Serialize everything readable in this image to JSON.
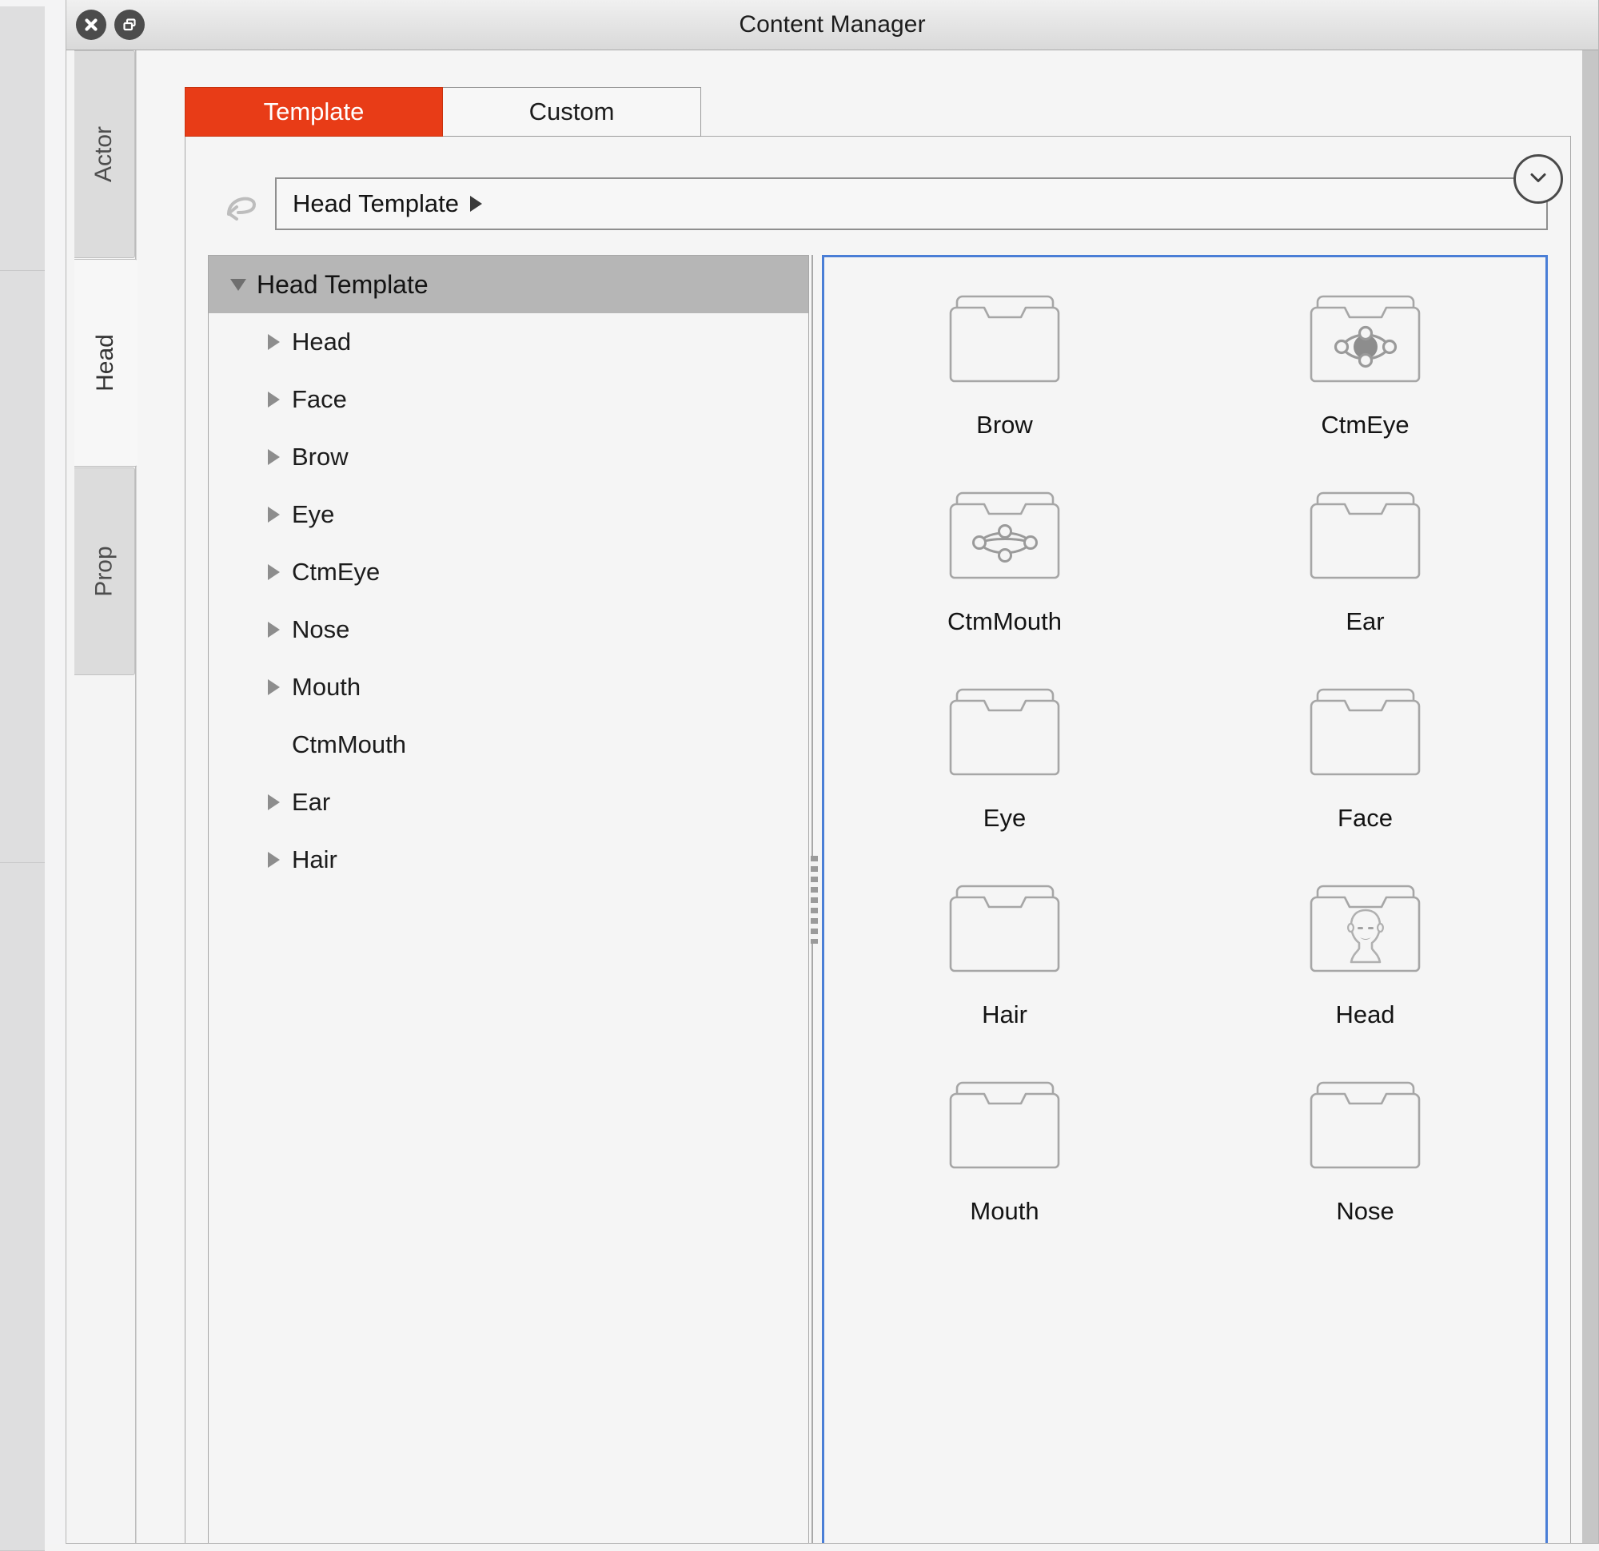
{
  "window": {
    "title": "Content Manager",
    "close_icon": "close-icon",
    "restore_icon": "restore-window-icon"
  },
  "side_tabs": [
    {
      "label": "Actor",
      "selected": false
    },
    {
      "label": "Head",
      "selected": true
    },
    {
      "label": "Prop",
      "selected": false
    }
  ],
  "tabs": [
    {
      "label": "Template",
      "active": true
    },
    {
      "label": "Custom",
      "active": false
    }
  ],
  "collapse_button": {
    "icon": "chevron-down-icon"
  },
  "breadcrumb": {
    "back_icon": "back-arrow-icon",
    "path": "Head Template",
    "arrow_icon": "caret-right-icon"
  },
  "tree": {
    "root": {
      "label": "Head Template",
      "expanded": true,
      "selected": true
    },
    "children": [
      {
        "label": "Head",
        "expandable": true
      },
      {
        "label": "Face",
        "expandable": true
      },
      {
        "label": "Brow",
        "expandable": true
      },
      {
        "label": "Eye",
        "expandable": true
      },
      {
        "label": "CtmEye",
        "expandable": true
      },
      {
        "label": "Nose",
        "expandable": true
      },
      {
        "label": "Mouth",
        "expandable": true
      },
      {
        "label": "CtmMouth",
        "expandable": false
      },
      {
        "label": "Ear",
        "expandable": true
      },
      {
        "label": "Hair",
        "expandable": true
      }
    ]
  },
  "splitter": {
    "icon": "drag-handle-icon"
  },
  "grid": {
    "items": [
      {
        "label": "Brow",
        "icon": "folder-plain-icon"
      },
      {
        "label": "CtmEye",
        "icon": "folder-eye-icon"
      },
      {
        "label": "CtmMouth",
        "icon": "folder-mouth-icon"
      },
      {
        "label": "Ear",
        "icon": "folder-plain-icon"
      },
      {
        "label": "Eye",
        "icon": "folder-plain-icon"
      },
      {
        "label": "Face",
        "icon": "folder-plain-icon"
      },
      {
        "label": "Hair",
        "icon": "folder-plain-icon"
      },
      {
        "label": "Head",
        "icon": "folder-head-icon"
      },
      {
        "label": "Mouth",
        "icon": "folder-plain-icon"
      },
      {
        "label": "Nose",
        "icon": "folder-plain-icon"
      }
    ]
  },
  "colors": {
    "accent": "#e83c17",
    "selection_border": "#4a7ed6",
    "tree_selection": "#b6b6b6",
    "panel_bg": "#f5f5f5"
  }
}
